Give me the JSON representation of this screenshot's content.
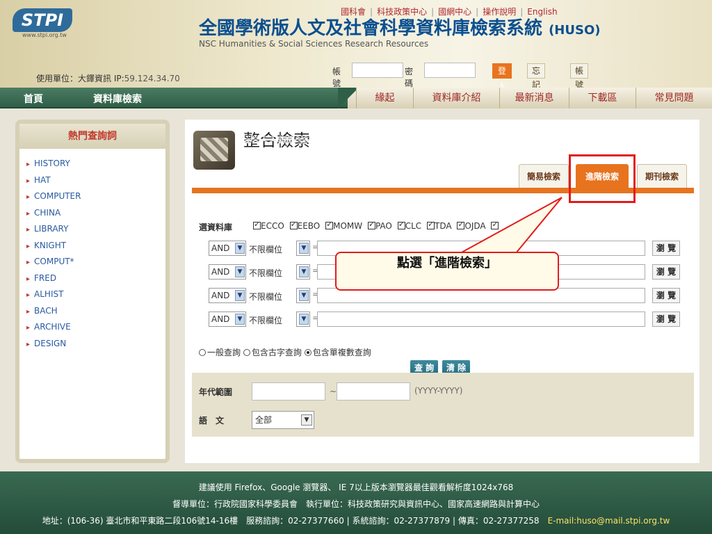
{
  "header": {
    "logo_text": "STPI",
    "logo_url": "www.stpi.org.tw",
    "unit_label": "使用單位：大鐸資訊 IP:",
    "unit_ip": "59.124.34.70",
    "title": "全國學術版人文及社會科學資料庫檢索系統",
    "title_suffix": "(HUSO)",
    "subtitle": "NSC Humanities & Social Sciences Research Resources",
    "top_links": [
      "國科會",
      "科技政策中心",
      "國網中心",
      "操作說明",
      "English"
    ],
    "account_label": "帳號",
    "password_label": "密碼",
    "login_button": "登入",
    "forgot_button": "忘記密碼",
    "apply_button": "帳號申請"
  },
  "nav": {
    "left": [
      "首頁",
      "資料庫檢索"
    ],
    "right": [
      "緣起",
      "資料庫介紹",
      "最新消息",
      "下載區",
      "常見問題"
    ]
  },
  "sidebar": {
    "title": "熱門查詢詞",
    "items": [
      "HISTORY",
      "HAT",
      "COMPUTER",
      "CHINA",
      "LIBRARY",
      "KNIGHT",
      "COMPUT*",
      "FRED",
      "ALHIST",
      "BACH",
      "ARCHIVE",
      "DESIGN"
    ]
  },
  "main": {
    "title": "整合檢索",
    "tabs": [
      "簡易檢索",
      "進階檢索",
      "期刊檢索"
    ],
    "active_tab": "進階檢索",
    "db_label": "選資料庫",
    "databases": [
      "ECCO",
      "EEBO",
      "MOMW",
      "PAO",
      "CLC",
      "TDA",
      "OJDA"
    ],
    "criteria": [
      {
        "op": "AND",
        "field": "不限欄位",
        "eq": "=",
        "browse": "瀏 覽"
      },
      {
        "op": "AND",
        "field": "不限欄位",
        "eq": "=",
        "browse": "瀏 覽"
      },
      {
        "op": "AND",
        "field": "不限欄位",
        "eq": "=",
        "browse": "瀏 覽"
      },
      {
        "op": "AND",
        "field": "不限欄位",
        "eq": "=",
        "browse": "瀏 覽"
      }
    ],
    "options": [
      "一般查詢",
      "包含古字查詢",
      "包含單複數查詢"
    ],
    "selected_option": "包含單複數查詢",
    "search_button": "查 詢",
    "clear_button": "清 除",
    "range_label": "年代範圍",
    "range_sep": "~",
    "range_format": "(YYYY-YYYY)",
    "lang_label": "語　文",
    "lang_value": "全部"
  },
  "callout": {
    "text": "點選「進階檢索」"
  },
  "footer": {
    "line1": "建議使用 Firefox、Google 瀏覽器、 IE 7以上版本瀏覽器最佳觀看解析度1024x768",
    "line2": "督導單位：行政院國家科學委員會　執行單位：科技政策研究與資訊中心、國家高速網路與計算中心",
    "line3": "地址：(106-36) 臺北市和平東路二段106號14-16樓　服務諮詢：02-27377660 | 系統諮詢：02-27377879 | 傳真：02-27377258",
    "email": "E-mail:huso@mail.stpi.org.tw"
  },
  "colors": {
    "accent": "#e8731e",
    "nav_green": "#2f5f47",
    "highlight_red": "#e21b1b",
    "link_blue": "#2a5aa0"
  }
}
